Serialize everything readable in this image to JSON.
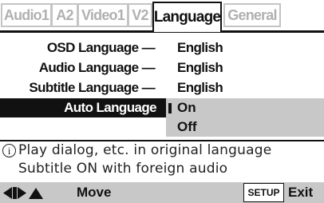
{
  "tabs": [
    {
      "label": "Audio1",
      "active": false
    },
    {
      "label": "A2",
      "active": false
    },
    {
      "label": "Video1",
      "active": false
    },
    {
      "label": "V2",
      "active": false
    },
    {
      "label": "Language",
      "active": true
    },
    {
      "label": "General",
      "active": false
    }
  ],
  "settings": [
    {
      "label": "OSD Language",
      "separator": "—",
      "value": "English"
    },
    {
      "label": "Audio Language",
      "separator": "—",
      "value": "English"
    },
    {
      "label": "Subtitle Language",
      "separator": "—",
      "value": "English"
    }
  ],
  "selected": {
    "label": "Auto Language"
  },
  "options": [
    {
      "label": "On",
      "current": true
    },
    {
      "label": "Off",
      "current": false
    }
  ],
  "info": {
    "icon": "info-icon",
    "glyph": "i",
    "line1": "Play dialog, etc. in original language",
    "line2": "Subtitle ON with foreign audio"
  },
  "footer": {
    "nav_icons": "arrow-left-right-up-icon",
    "move_label": "Move",
    "setup_label": "SETUP",
    "exit_label": "Exit"
  },
  "colors": {
    "selection": "#111111",
    "panel_gray": "#c8c8c8",
    "inactive_tab_text": "#b0b0b0"
  }
}
